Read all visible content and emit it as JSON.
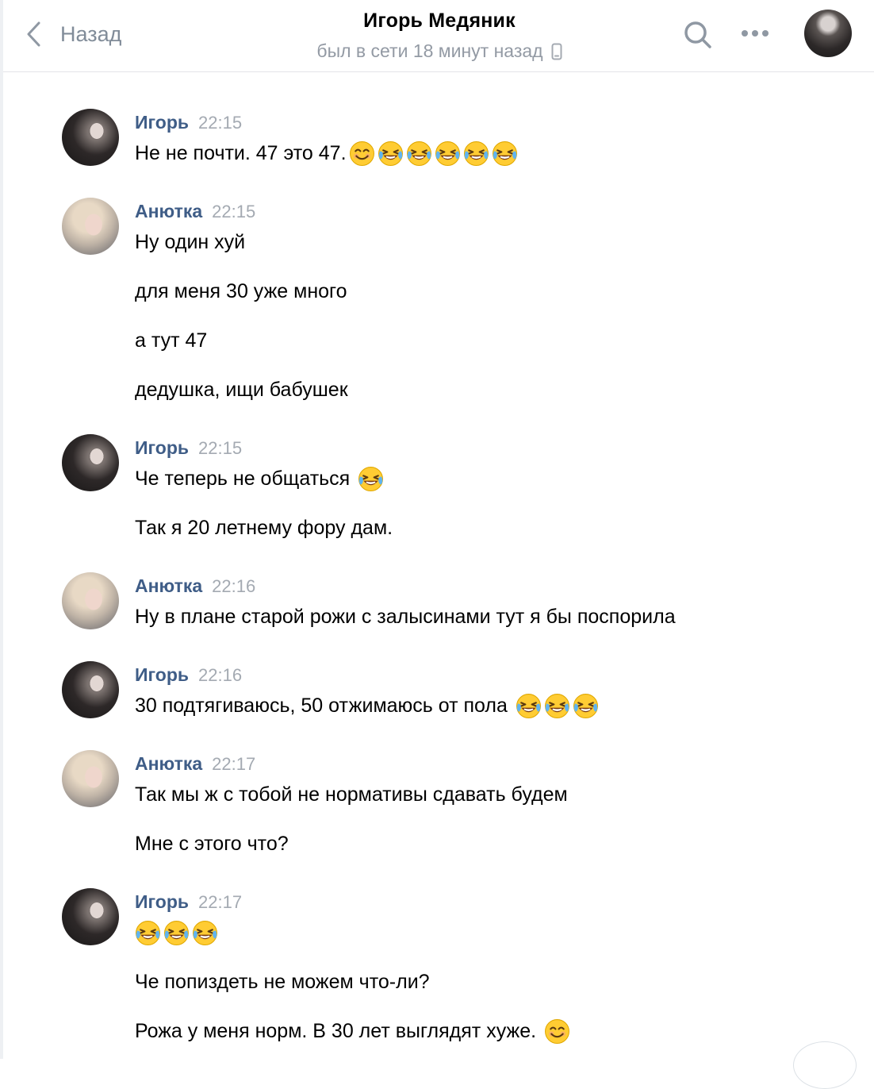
{
  "header": {
    "back_label": "Назад",
    "title": "Игорь Медяник",
    "status": "был в сети 18 минут назад"
  },
  "messages": [
    {
      "author": "Игорь",
      "time": "22:15",
      "avatar": "igor",
      "lines": [
        {
          "text": "Не не почти. 47 это 47.",
          "emoji": [
            "smile",
            "tears-of-joy",
            "tears-of-joy",
            "tears-of-joy",
            "tears-of-joy",
            "tears-of-joy"
          ]
        }
      ]
    },
    {
      "author": "Анютка",
      "time": "22:15",
      "avatar": "anna",
      "lines": [
        {
          "text": "Ну один хуй"
        },
        {
          "text": "для меня 30 уже много"
        },
        {
          "text": "а тут 47"
        },
        {
          "text": "дедушка, ищи бабушек"
        }
      ]
    },
    {
      "author": "Игорь",
      "time": "22:15",
      "avatar": "igor",
      "lines": [
        {
          "text": "Че теперь не общаться ",
          "emoji": [
            "tears-of-joy"
          ]
        },
        {
          "text": "Так я 20 летнему фору дам."
        }
      ]
    },
    {
      "author": "Анютка",
      "time": "22:16",
      "avatar": "anna",
      "lines": [
        {
          "text": "Ну в плане старой рожи с залысинами тут я бы поспорила"
        }
      ]
    },
    {
      "author": "Игорь",
      "time": "22:16",
      "avatar": "igor",
      "lines": [
        {
          "text": "30 подтягиваюсь, 50 отжимаюсь от пола ",
          "emoji": [
            "tears-of-joy",
            "tears-of-joy",
            "tears-of-joy"
          ]
        }
      ]
    },
    {
      "author": "Анютка",
      "time": "22:17",
      "avatar": "anna",
      "lines": [
        {
          "text": "Так мы ж с тобой не нормативы сдавать будем"
        },
        {
          "text": "Мне с этого что?"
        }
      ]
    },
    {
      "author": "Игорь",
      "time": "22:17",
      "avatar": "igor",
      "lines": [
        {
          "text": "",
          "emoji": [
            "tears-of-joy",
            "tears-of-joy",
            "tears-of-joy"
          ]
        },
        {
          "text": "Че попиздеть не можем что-ли?"
        },
        {
          "text": "Рожа у меня норм. В 30 лет выглядят хуже. ",
          "emoji": [
            "smile"
          ]
        }
      ]
    }
  ],
  "icons": {
    "back": "chevron-left-icon",
    "search": "search-icon",
    "more": "more-dots-icon",
    "mobile": "mobile-phone-icon"
  },
  "colors": {
    "author": "#3f5d87",
    "time": "#a4aab2",
    "muted": "#818c99"
  }
}
